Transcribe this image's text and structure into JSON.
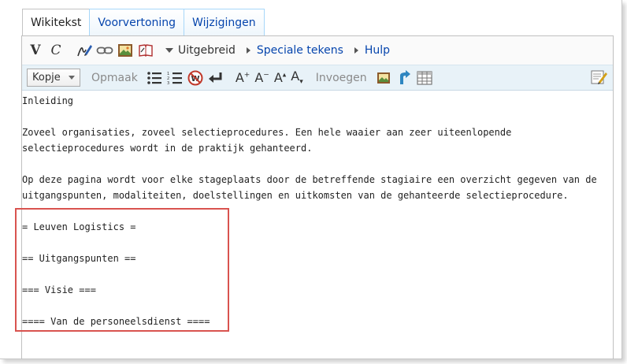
{
  "tabs": [
    {
      "label": "Wikitekst",
      "active": true
    },
    {
      "label": "Voorvertoning",
      "active": false
    },
    {
      "label": "Wijzigingen",
      "active": false
    }
  ],
  "toolbar1": {
    "bold_glyph": "V",
    "italic_glyph": "C",
    "icons": [
      "signature-icon",
      "link-icon",
      "embed-image-icon",
      "reference-book-icon"
    ],
    "menus": [
      {
        "label": "Uitgebreid",
        "kind": "dropdown"
      },
      {
        "label": "Speciale tekens",
        "kind": "expand"
      },
      {
        "label": "Hulp",
        "kind": "expand"
      }
    ]
  },
  "toolbar2": {
    "heading_select": "Kopje",
    "format_label": "Opmaak",
    "insert_label": "Invoegen",
    "font_buttons": [
      "A",
      "A",
      "A",
      "A"
    ]
  },
  "text_lines": [
    "Inleiding",
    "",
    "Zoveel organisaties, zoveel selectieprocedures. Een hele waaier aan zeer uiteenlopende",
    "selectieprocedures wordt in de praktijk gehanteerd.",
    "",
    "Op deze pagina wordt voor elke stageplaats door de betreffende stagiaire een overzicht gegeven van de",
    "uitgangspunten, modaliteiten, doelstellingen en uitkomsten van de gehanteerde selectieprocedure.",
    "",
    "= Leuven Logistics =",
    "",
    "== Uitgangspunten ==",
    "",
    "=== Visie ===",
    "",
    "==== Van de personeelsdienst ===="
  ],
  "colors": {
    "link": "#0645ad",
    "highlight": "#d9534f",
    "toolbar_bg": "#e8f2f8"
  }
}
